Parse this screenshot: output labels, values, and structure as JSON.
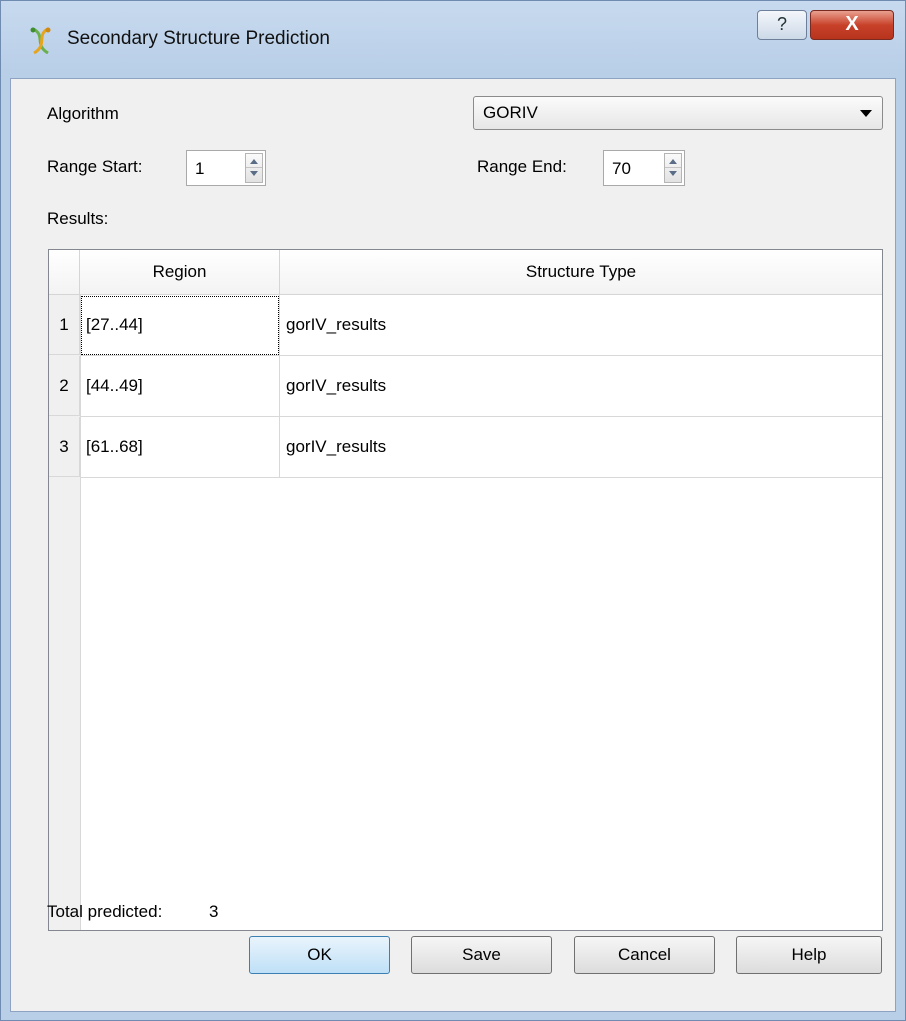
{
  "window": {
    "title": "Secondary Structure Prediction",
    "help_label": "?",
    "close_label": "X"
  },
  "algorithm": {
    "label": "Algorithm",
    "selected": "GORIV"
  },
  "range": {
    "start_label": "Range Start:",
    "start_value": "1",
    "end_label": "Range End:",
    "end_value": "70"
  },
  "results": {
    "label": "Results:",
    "columns": [
      "Region",
      "Structure Type"
    ],
    "rows": [
      {
        "num": "1",
        "region": "[27..44]",
        "type": "gorIV_results"
      },
      {
        "num": "2",
        "region": "[44..49]",
        "type": "gorIV_results"
      },
      {
        "num": "3",
        "region": "[61..68]",
        "type": "gorIV_results"
      }
    ]
  },
  "total": {
    "label": "Total predicted:",
    "value": "3"
  },
  "buttons": {
    "ok": "OK",
    "save": "Save",
    "cancel": "Cancel",
    "help": "Help"
  },
  "colors": {
    "titlebar": "#b9cfe8",
    "close": "#c8422a",
    "default_button": "#bfe0f7"
  },
  "icons": {
    "app": "dna-helix-icon",
    "help": "question-icon",
    "close": "close-icon",
    "combo_arrow": "chevron-down-icon",
    "spin_up": "arrow-up-icon",
    "spin_down": "arrow-down-icon"
  }
}
